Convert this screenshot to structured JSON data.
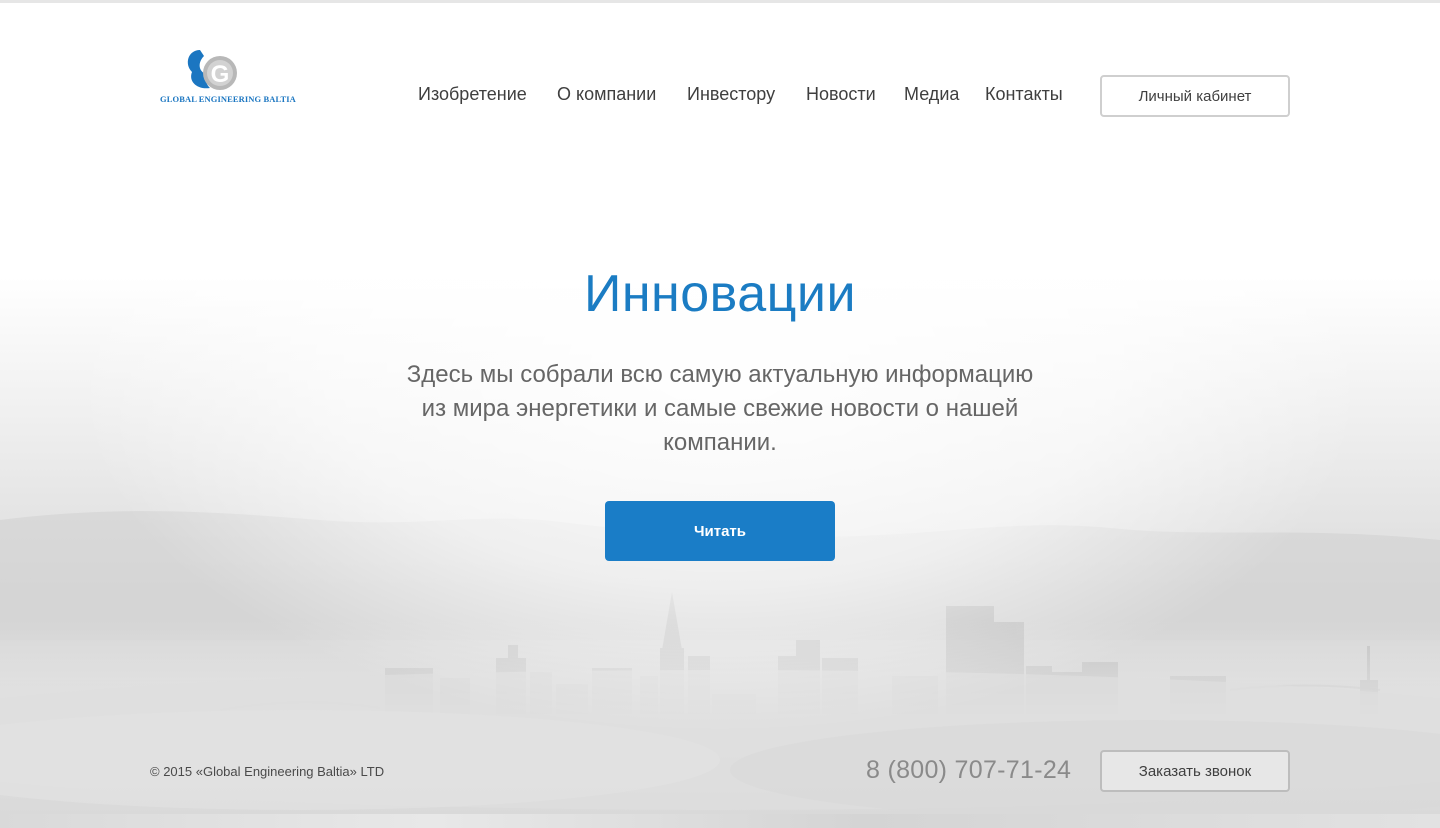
{
  "brand": {
    "logo_letter": "G",
    "logo_text": "GLOBAL ENGINEERING BALTIA",
    "logo_color": "#1b76c1"
  },
  "nav": {
    "items": [
      {
        "label": "Изобретение"
      },
      {
        "label": "О компании"
      },
      {
        "label": "Инвестору"
      },
      {
        "label": "Новости"
      },
      {
        "label": "Медиа"
      },
      {
        "label": "Контакты"
      }
    ],
    "cabinet_label": "Личный кабинет"
  },
  "hero": {
    "title": "Инновации",
    "subtitle": "Здесь мы собрали всю самую актуальную информацию из мира энергетики и самые свежие новости о нашей компании.",
    "button_label": "Читать",
    "accent_color": "#1a7dc7"
  },
  "footer": {
    "copyright": "© 2015 «Global Engineering Baltia» LTD",
    "phone": "8 (800) 707-71-24",
    "callback_label": "Заказать звонок"
  }
}
